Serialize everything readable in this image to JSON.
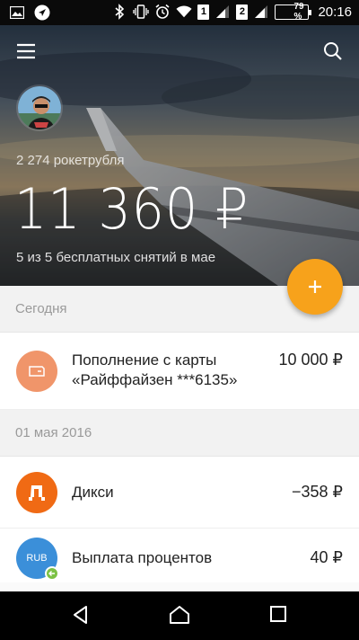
{
  "status_bar": {
    "sim1": "1",
    "sim2": "2",
    "battery_percent": "79 %",
    "battery_level": 0.79,
    "time": "20:16",
    "left_icons": [
      "image-icon",
      "navigation-icon"
    ],
    "right_icons": [
      "bluetooth-icon",
      "vibrate-icon",
      "alarm-icon",
      "wifi-icon",
      "signal-icon"
    ]
  },
  "header": {
    "rockets": "2 274 рокетрубля",
    "balance": "11 360 ₽",
    "withdrawals": "5 из 5 бесплатных снятий в мае",
    "background": "airplane-wing-sunset"
  },
  "fab": {
    "icon": "plus-icon",
    "color": "#f7a21b"
  },
  "sections": [
    {
      "title": "Сегодня",
      "items": [
        {
          "title_line1": "Пополнение с карты",
          "title_line2": "«Райффайзен ***6135»",
          "amount": "10 000 ₽",
          "icon": "card-icon",
          "icon_color": "#f0956a"
        }
      ]
    },
    {
      "title": "01 мая 2016",
      "items": [
        {
          "title": "Дикси",
          "amount": "−358 ₽",
          "icon_text": "Д",
          "icon_color": "#f06a14"
        },
        {
          "title": "Выплата процентов",
          "amount": "40 ₽",
          "icon_text": "RUB",
          "icon_color": "#3b8fd9",
          "badge_color": "#7bc144"
        }
      ]
    }
  ],
  "navbar": {
    "buttons": [
      "back-icon",
      "home-icon",
      "recents-icon"
    ]
  }
}
